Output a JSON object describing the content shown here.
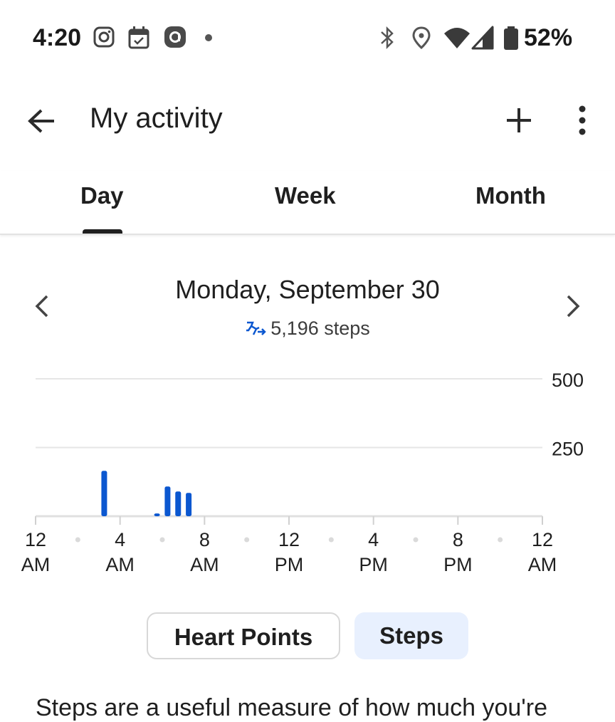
{
  "status_bar": {
    "time": "4:20",
    "battery_percent": "52%",
    "notification_icons": [
      "instagram-icon",
      "calendar-check-icon",
      "app-notification-icon",
      "more-notifications-dot-icon"
    ],
    "system_icons": [
      "bluetooth-icon",
      "location-icon",
      "wifi-icon",
      "cell-signal-icon",
      "battery-icon"
    ]
  },
  "app_bar": {
    "title": "My activity",
    "back_icon": "arrow-back-icon",
    "add_icon": "plus-icon",
    "more_icon": "more-vert-icon"
  },
  "tabs": [
    {
      "label": "Day",
      "selected": true
    },
    {
      "label": "Week",
      "selected": false
    },
    {
      "label": "Month",
      "selected": false
    }
  ],
  "date_nav": {
    "date": "Monday, September 30",
    "steps_total": "5,196 steps",
    "prev_icon": "chevron-left-icon",
    "next_icon": "chevron-right-icon"
  },
  "chart_data": {
    "type": "bar",
    "unit": "steps per interval",
    "ylim": [
      0,
      500
    ],
    "y_ticks": [
      "500",
      "250"
    ],
    "x_ticks": [
      {
        "l1": "12",
        "l2": "AM",
        "h": 0
      },
      {
        "l1": "4",
        "l2": "AM",
        "h": 4
      },
      {
        "l1": "8",
        "l2": "AM",
        "h": 8
      },
      {
        "l1": "12",
        "l2": "PM",
        "h": 12
      },
      {
        "l1": "4",
        "l2": "PM",
        "h": 16
      },
      {
        "l1": "8",
        "l2": "PM",
        "h": 20
      },
      {
        "l1": "12",
        "l2": "AM",
        "h": 24
      }
    ],
    "bars": [
      {
        "hour": 3.25,
        "value": 165
      },
      {
        "hour": 5.75,
        "value": 10
      },
      {
        "hour": 6.25,
        "value": 108
      },
      {
        "hour": 6.75,
        "value": 90
      },
      {
        "hour": 7.25,
        "value": 85
      }
    ],
    "bar_color": "#0b57d0",
    "grid": true
  },
  "metric_toggle": {
    "options": [
      "Heart Points",
      "Steps"
    ],
    "selected": "Steps"
  },
  "description": "Steps are a useful measure of how much you're"
}
